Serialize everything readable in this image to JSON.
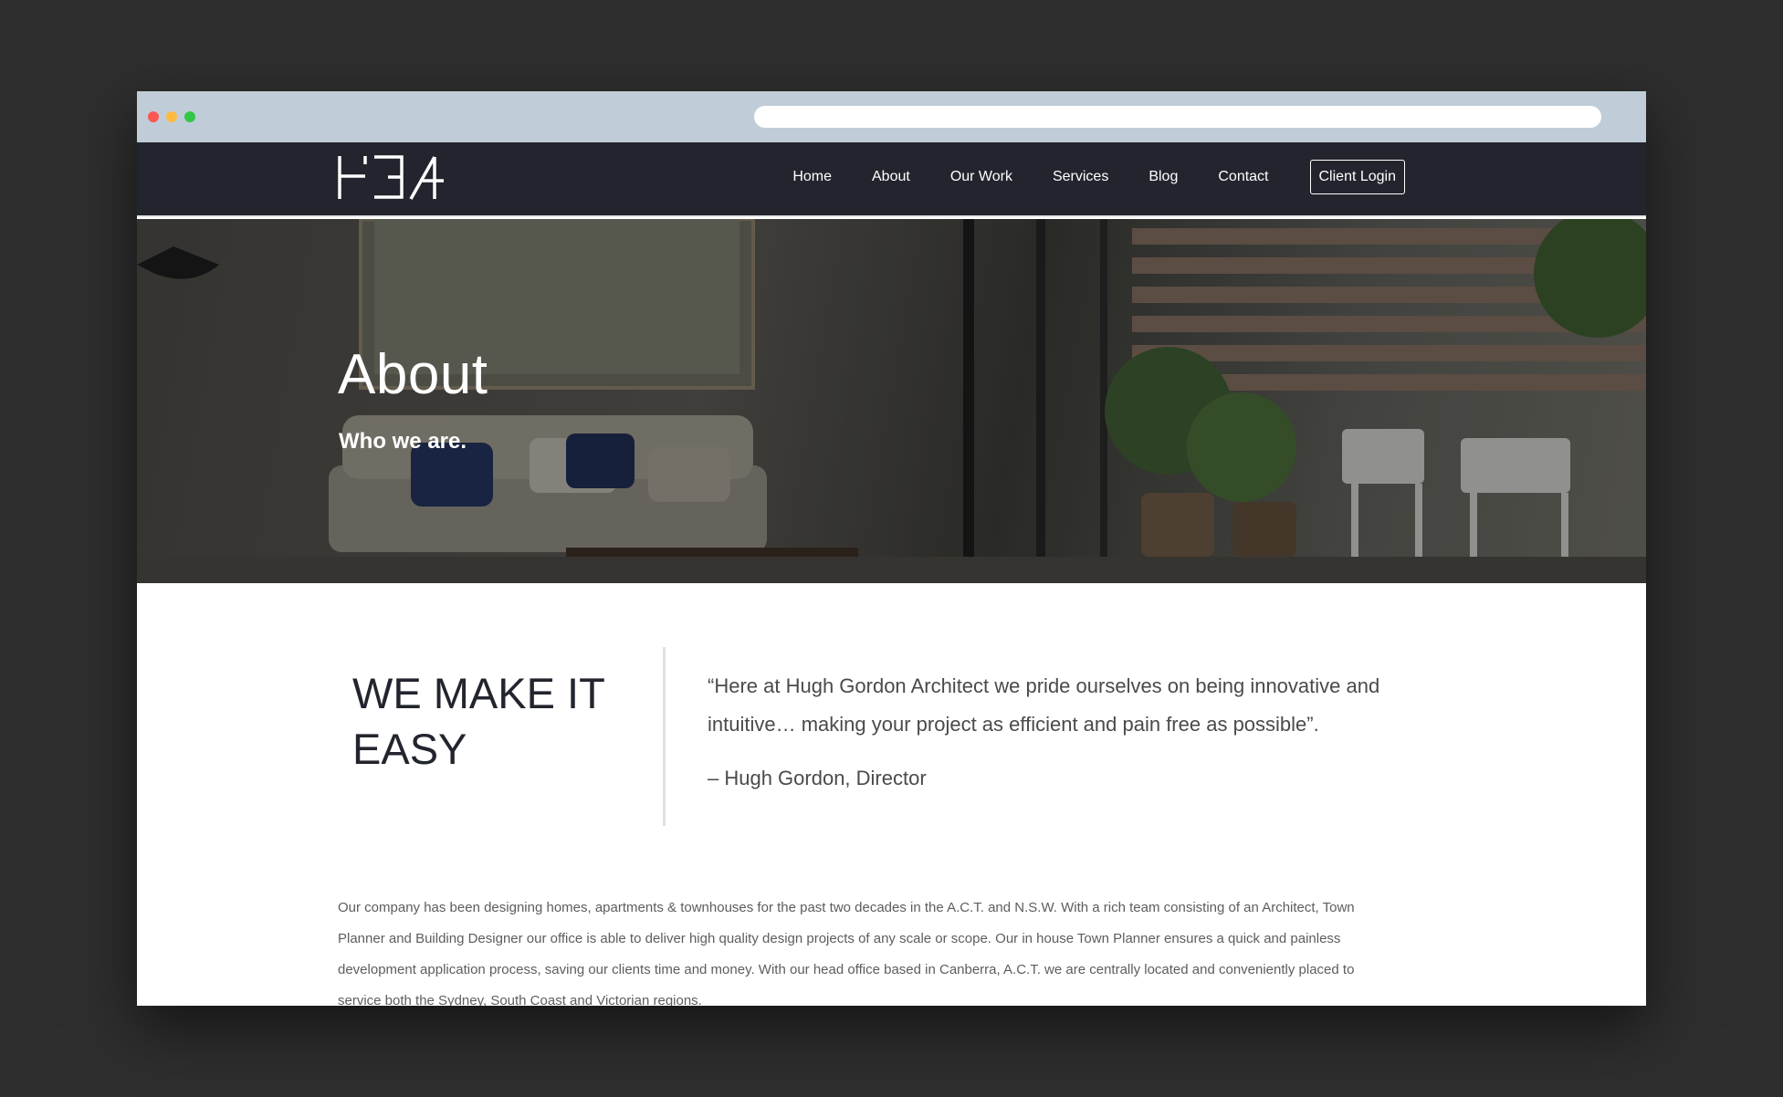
{
  "nav": {
    "links": [
      "Home",
      "About",
      "Our Work",
      "Services",
      "Blog",
      "Contact"
    ],
    "client_login": "Client Login"
  },
  "hero": {
    "title": "About",
    "subtitle": "Who we are."
  },
  "intro": {
    "heading": "WE MAKE IT EASY",
    "quote": "“Here at Hugh Gordon Architect we pride ourselves on being innovative and intuitive… making your project as efficient and pain free as possible”.",
    "attribution": "– Hugh Gordon, Director",
    "body": "Our company has been designing homes, apartments & townhouses for the past two decades in the A.C.T. and N.S.W. With a rich team consisting of an Architect, Town Planner and Building Designer our office is able to deliver high quality design projects of any scale or scope. Our in house Town Planner ensures a quick and painless development application process, saving our clients time and money. With our head office based in Canberra, A.C.T. we are centrally located and conveniently placed to service both the Sydney, South Coast and Victorian regions."
  },
  "colors": {
    "page_background": "#2e2e2e",
    "chrome_bar": "#c0cdd8",
    "navbar": "#23252e",
    "accent_text": "#23252e"
  },
  "icons": [
    "window-close-dot",
    "window-minimize-dot",
    "window-maximize-dot",
    "hga-logo"
  ]
}
